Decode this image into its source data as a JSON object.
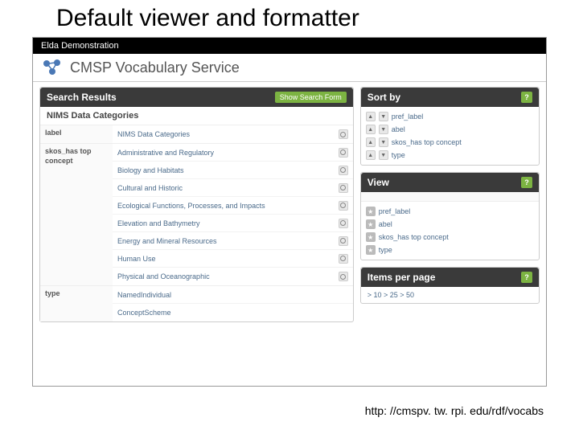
{
  "slide": {
    "title": "Default viewer and formatter",
    "footer_url": "http: //cmspv. tw. rpi. edu/rdf/vocabs"
  },
  "topbar": {
    "title": "Elda Demonstration"
  },
  "service": {
    "title": "CMSP Vocabulary Service"
  },
  "results": {
    "header": "Search Results",
    "show_form": "Show Search Form",
    "group_title": "NIMS Data Categories",
    "rows": [
      {
        "label": "label",
        "values": [
          "NIMS Data Categories"
        ]
      },
      {
        "label": "skos_has top concept",
        "values": [
          "Administrative and Regulatory",
          "Biology and Habitats",
          "Cultural and Historic",
          "Ecological Functions, Processes, and Impacts",
          "Elevation and Bathymetry",
          "Energy and Mineral Resources",
          "Human Use",
          "Physical and Oceanographic"
        ]
      },
      {
        "label": "type",
        "values": [
          "NamedIndividual",
          "ConceptScheme"
        ]
      }
    ]
  },
  "sortby": {
    "header": "Sort by",
    "help": "?",
    "items": [
      "pref_label",
      "abel",
      "skos_has top concept",
      "type"
    ]
  },
  "view": {
    "header": "View",
    "help": "?",
    "items": [
      "pref_label",
      "abel",
      "skos_has top concept",
      "type"
    ]
  },
  "ipp": {
    "header": "Items per page",
    "help": "?",
    "text": "> 10  > 25  > 50"
  }
}
